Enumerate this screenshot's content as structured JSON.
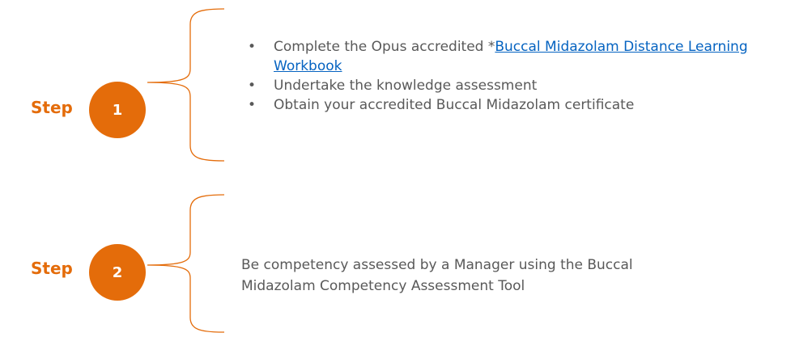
{
  "colors": {
    "accent": "#E46C0A",
    "text": "#595959",
    "link": "#0563C1"
  },
  "step1": {
    "label": "Step",
    "number": "1",
    "bullet_glyph": "•",
    "bullets": {
      "b0_prefix": "Complete the Opus accredited *",
      "b0_link": "Buccal Midazolam Distance Learning Workbook",
      "b1": "Undertake the knowledge assessment",
      "b2": "Obtain your accredited Buccal Midazolam certificate"
    }
  },
  "step2": {
    "label": "Step",
    "number": "2",
    "text": "Be competency assessed by a Manager using the Buccal Midazolam Competency Assessment Tool"
  }
}
